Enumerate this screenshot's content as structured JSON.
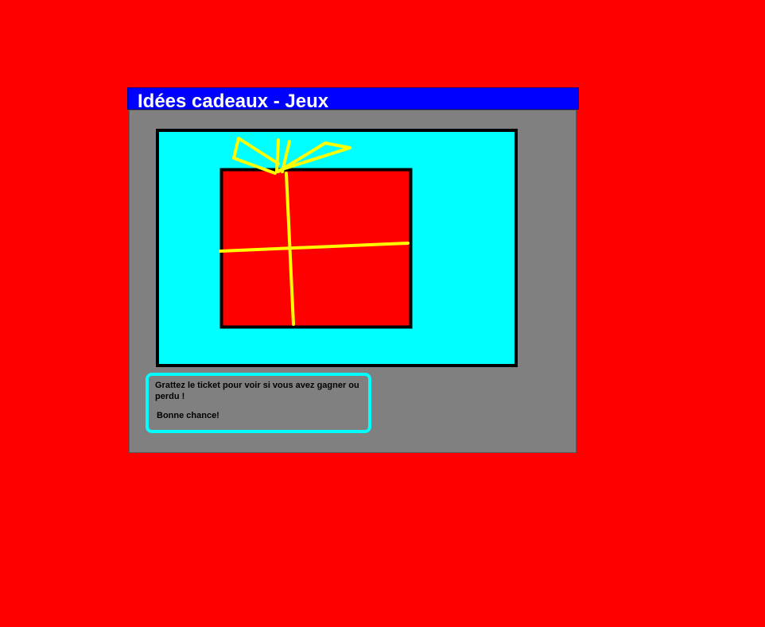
{
  "page": {
    "background_color": "#ff0000"
  },
  "window": {
    "title": "Idées cadeaux - Jeux",
    "title_bar_color": "#0000ff",
    "panel_color": "#808080"
  },
  "scratch_ticket": {
    "background_color": "#00ffff",
    "gift_icon": "gift-icon",
    "gift_color": "#ff0000",
    "ribbon_color": "#ffff00"
  },
  "instructions": {
    "line1": "Grattez le ticket pour voir si vous avez gagner ou perdu !",
    "line2": "Bonne chance!",
    "border_color": "#00ffff"
  }
}
